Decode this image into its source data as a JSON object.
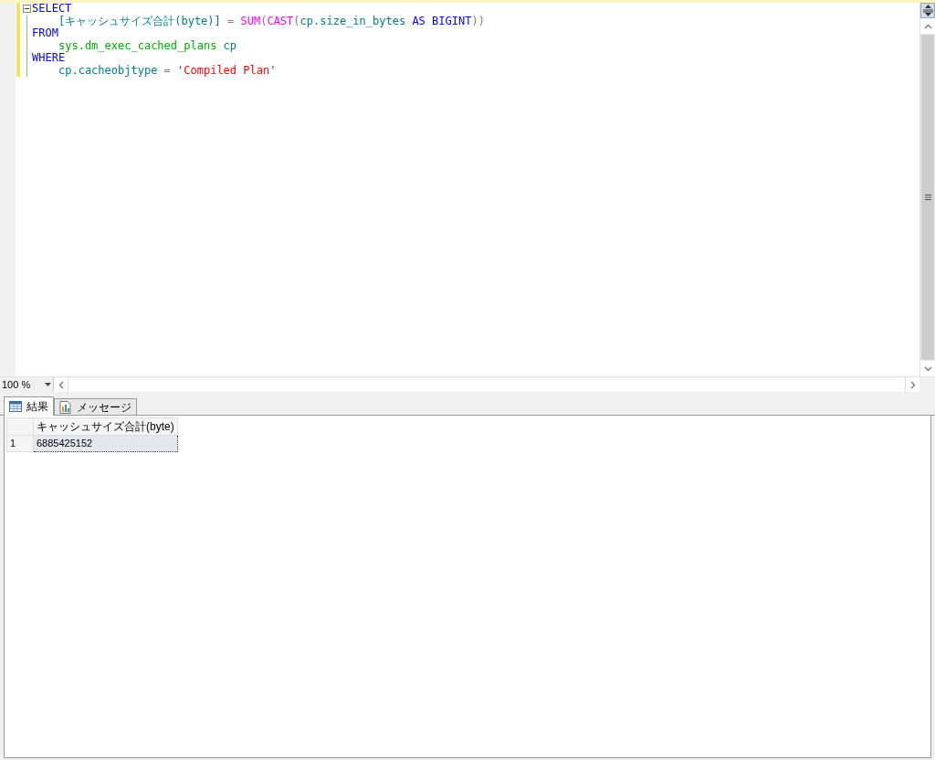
{
  "editor": {
    "lines": [
      {
        "collapsible": true,
        "indented": false,
        "tokens": [
          {
            "kind": "keyword",
            "text": "SELECT"
          }
        ]
      },
      {
        "collapsible": false,
        "indented": true,
        "tokens": [
          {
            "kind": "identifier",
            "text": "[キャッシュサイズ合計(byte)]"
          },
          {
            "kind": "operator",
            "text": " = "
          },
          {
            "kind": "function",
            "text": "SUM"
          },
          {
            "kind": "operator",
            "text": "("
          },
          {
            "kind": "function",
            "text": "CAST"
          },
          {
            "kind": "operator",
            "text": "("
          },
          {
            "kind": "identifier",
            "text": "cp.size_in_bytes "
          },
          {
            "kind": "keyword",
            "text": "AS BIGINT"
          },
          {
            "kind": "operator",
            "text": "))"
          }
        ]
      },
      {
        "collapsible": false,
        "indented": false,
        "tokens": [
          {
            "kind": "keyword",
            "text": "FROM"
          }
        ]
      },
      {
        "collapsible": false,
        "indented": true,
        "tokens": [
          {
            "kind": "system",
            "text": "sys.dm_exec_cached_plans"
          },
          {
            "kind": "identifier",
            "text": " cp"
          }
        ]
      },
      {
        "collapsible": false,
        "indented": false,
        "tokens": [
          {
            "kind": "keyword",
            "text": "WHERE"
          }
        ]
      },
      {
        "collapsible": false,
        "indented": true,
        "tokens": [
          {
            "kind": "identifier",
            "text": "cp.cacheobjtype "
          },
          {
            "kind": "operator",
            "text": "= "
          },
          {
            "kind": "string",
            "text": "'Compiled Plan'"
          }
        ]
      }
    ]
  },
  "zoom": {
    "value": "100 %"
  },
  "tabs": [
    {
      "label": "結果",
      "kind": "grid",
      "selected": true
    },
    {
      "label": "メッセージ",
      "kind": "messages",
      "selected": false
    }
  ],
  "results": {
    "columns": [
      "キャッシュサイズ合計(byte)"
    ],
    "rows": [
      {
        "number": "1",
        "cells": [
          "6885425152"
        ]
      }
    ]
  }
}
